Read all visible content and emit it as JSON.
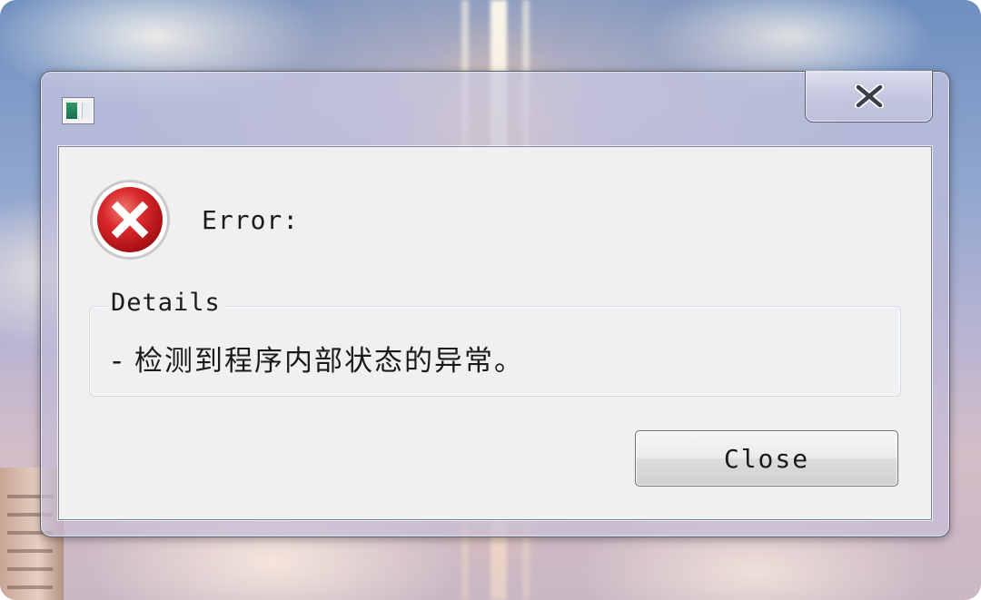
{
  "dialog": {
    "title_icon": "window-app-icon",
    "close_icon": "close-x-icon",
    "error_icon": "error-circle-icon",
    "error_label": "Error:",
    "details": {
      "legend": "Details",
      "message": "- 检测到程序内部状态的异常。"
    },
    "close_button_label": "Close"
  },
  "colors": {
    "error_red": "#c8181c",
    "client_bg": "#f0f0f0",
    "text": "#1a1a1a"
  }
}
